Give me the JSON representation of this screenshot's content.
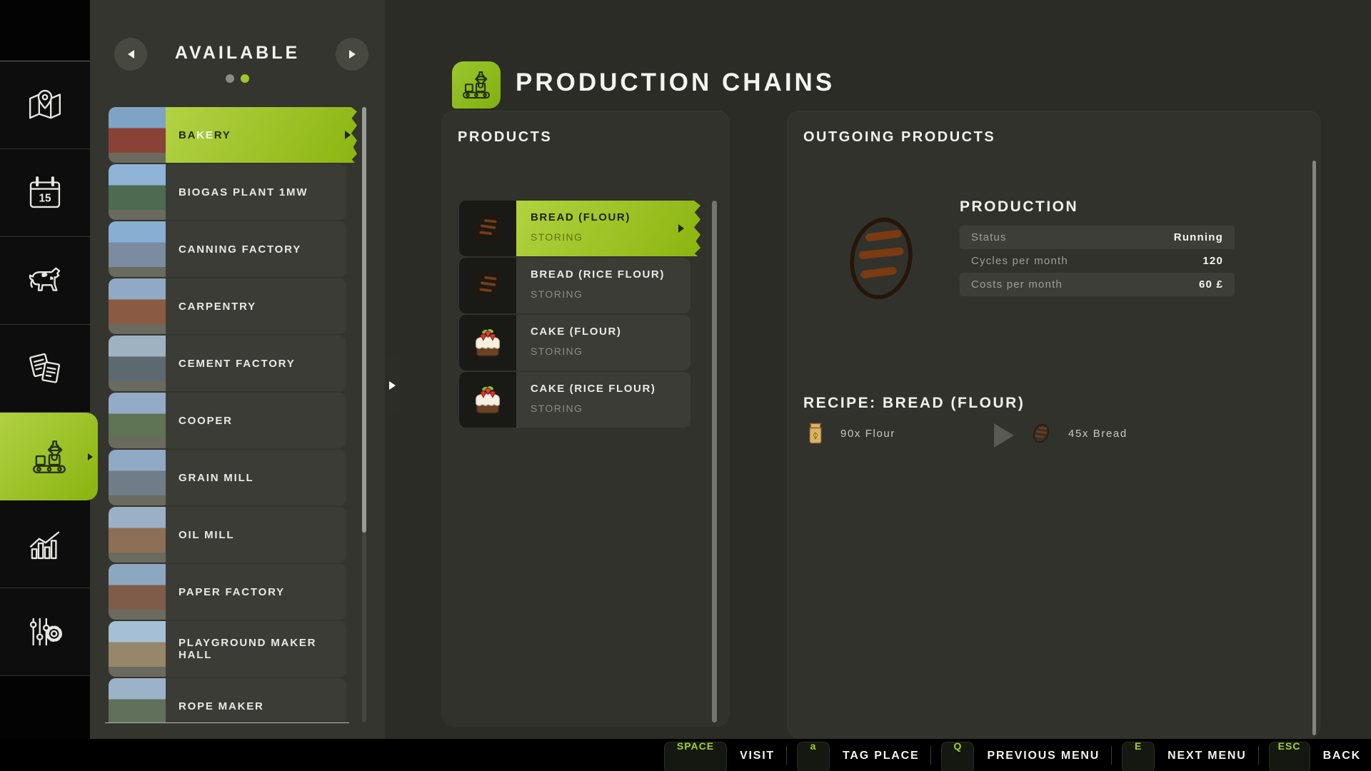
{
  "colors": {
    "accent_green": "#9cc828",
    "selected_gradient_from": "#b2d244",
    "selected_gradient_to": "#8cb511",
    "key_text_green": "#a5cf2b"
  },
  "sidebar": {
    "calendar_day": "15",
    "items": [
      {
        "icon": "map-icon",
        "active": false
      },
      {
        "icon": "calendar-icon",
        "active": false
      },
      {
        "icon": "animals-icon",
        "active": false
      },
      {
        "icon": "contracts-icon",
        "active": false
      },
      {
        "icon": "production-icon",
        "active": true
      },
      {
        "icon": "statistics-icon",
        "active": false
      },
      {
        "icon": "settings-icon",
        "active": false
      }
    ]
  },
  "buildings": {
    "header": "AVAILABLE",
    "page_dots": [
      {
        "active": false
      },
      {
        "active": true
      }
    ],
    "items": [
      {
        "label": "BAKERY",
        "highlight": "KE",
        "selected": true,
        "thumb": [
          "#7ea3c4",
          "#8a4136"
        ]
      },
      {
        "label": "BIOGAS PLANT 1MW",
        "selected": false,
        "thumb": [
          "#8fb4d8",
          "#4c6b50"
        ]
      },
      {
        "label": "CANNING FACTORY",
        "selected": false,
        "thumb": [
          "#88aed2",
          "#7b8ba0"
        ]
      },
      {
        "label": "CARPENTRY",
        "selected": false,
        "thumb": [
          "#90a9c5",
          "#8a5a42"
        ]
      },
      {
        "label": "CEMENT FACTORY",
        "selected": false,
        "thumb": [
          "#9fb2c2",
          "#5c6a70"
        ]
      },
      {
        "label": "COOPER",
        "selected": false,
        "thumb": [
          "#93abc6",
          "#5f7355"
        ]
      },
      {
        "label": "GRAIN MILL",
        "selected": false,
        "thumb": [
          "#8fa9c6",
          "#6f7d89"
        ]
      },
      {
        "label": "OIL MILL",
        "selected": false,
        "thumb": [
          "#9cb0c5",
          "#8d6e56"
        ]
      },
      {
        "label": "PAPER FACTORY",
        "selected": false,
        "thumb": [
          "#8ea7c0",
          "#7e5c49"
        ]
      },
      {
        "label": "PLAYGROUND MAKER HALL",
        "selected": false,
        "thumb": [
          "#a5bfd6",
          "#97876a"
        ]
      },
      {
        "label": "ROPE MAKER",
        "selected": false,
        "thumb": [
          "#9bb2c9",
          "#61705b"
        ]
      }
    ]
  },
  "main": {
    "title": "PRODUCTION CHAINS",
    "products": {
      "header": "PRODUCTS",
      "items": [
        {
          "label": "BREAD (FLOUR)",
          "status": "STORING",
          "icon": "bread",
          "selected": true
        },
        {
          "label": "BREAD (RICE FLOUR)",
          "status": "STORING",
          "icon": "bread",
          "selected": false
        },
        {
          "label": "CAKE (FLOUR)",
          "status": "STORING",
          "icon": "cake",
          "selected": false
        },
        {
          "label": "CAKE (RICE FLOUR)",
          "status": "STORING",
          "icon": "cake",
          "selected": false
        }
      ]
    },
    "outgoing": {
      "header": "OUTGOING PRODUCTS",
      "production": {
        "title": "PRODUCTION",
        "rows": [
          {
            "label": "Status",
            "value": "Running"
          },
          {
            "label": "Cycles per month",
            "value": "120"
          },
          {
            "label": "Costs per month",
            "value": "60 £"
          }
        ]
      },
      "recipe": {
        "title": "RECIPE: BREAD (FLOUR)",
        "input": {
          "qty": "90x",
          "name": "Flour",
          "icon": "flour-sack"
        },
        "output": {
          "qty": "45x",
          "name": "Bread",
          "icon": "bread"
        }
      }
    }
  },
  "footer": {
    "actions": [
      {
        "key": "SPACE",
        "label": "VISIT"
      },
      {
        "key": "a",
        "label": "TAG PLACE"
      },
      {
        "key": "Q",
        "label": "PREVIOUS MENU"
      },
      {
        "key": "E",
        "label": "NEXT MENU"
      },
      {
        "key": "ESC",
        "label": "BACK"
      }
    ]
  }
}
